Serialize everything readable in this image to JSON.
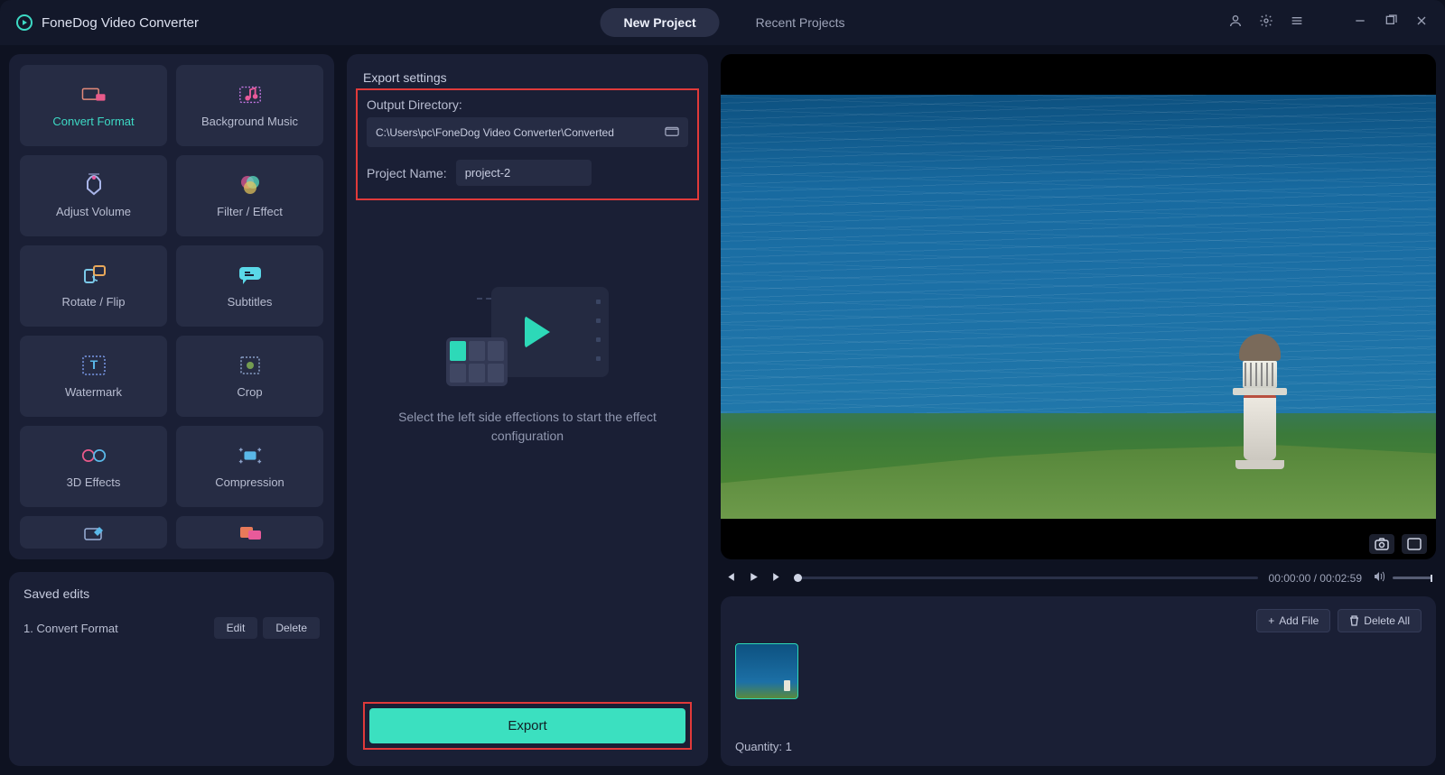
{
  "app_name": "FoneDog Video Converter",
  "tabs": {
    "new": "New Project",
    "recent": "Recent Projects"
  },
  "tools": [
    {
      "label": "Convert Format",
      "active": true
    },
    {
      "label": "Background Music"
    },
    {
      "label": "Adjust Volume"
    },
    {
      "label": "Filter / Effect"
    },
    {
      "label": "Rotate / Flip"
    },
    {
      "label": "Subtitles"
    },
    {
      "label": "Watermark"
    },
    {
      "label": "Crop"
    },
    {
      "label": "3D Effects"
    },
    {
      "label": "Compression"
    }
  ],
  "saved": {
    "title": "Saved edits",
    "row": "1.   Convert Format",
    "edit": "Edit",
    "delete": "Delete"
  },
  "export": {
    "panel_title": "Export settings",
    "dir_label": "Output Directory:",
    "dir_value": "C:\\Users\\pc\\FoneDog Video Converter\\Converted",
    "name_label": "Project Name:",
    "name_value": "project-2",
    "placeholder": "Select the left side effections to start the effect configuration",
    "button": "Export"
  },
  "player": {
    "time_current": "00:00:00",
    "time_total": "00:02:59"
  },
  "files": {
    "add": "Add File",
    "delete_all": "Delete All",
    "quantity_label": "Quantity:",
    "quantity_value": "1"
  }
}
